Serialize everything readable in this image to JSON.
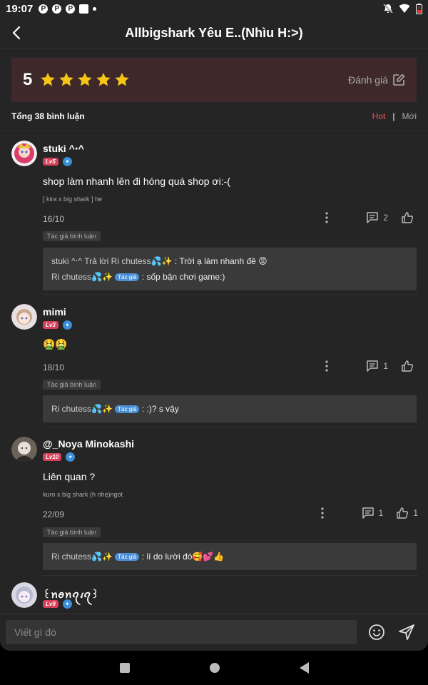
{
  "status_bar": {
    "time": "19:07",
    "pin_letter": "P"
  },
  "header": {
    "title": "Allbigshark Yêu E..(Nhìu H:>)"
  },
  "rating": {
    "score": "5",
    "stars": 5,
    "rate_label": "Đánh giá"
  },
  "summary": {
    "total_label": "Tổng 38 bình luận",
    "sort_hot": "Hot",
    "sort_sep": "|",
    "sort_new": "Mới"
  },
  "comments": [
    {
      "username": "stuki ^‧^",
      "level": "Lv5",
      "text": "shop làm nhanh lên đi hóng quá shop ơi:-(",
      "tag": "[ kira x big shark ] he",
      "date": "16/10",
      "reply_count": "2",
      "like_count": "",
      "author_tag": "Tác giả bình luận",
      "replies": [
        {
          "name": "stuki ^‧^",
          "verb": "Trả lời",
          "target": "Ri chutess💦✨",
          "badge": "",
          "text": ": Trời ạ làm nhanh đê 😡"
        },
        {
          "name": "Ri chutess💦✨",
          "verb": "",
          "target": "",
          "badge": "Tác giả",
          "text": ": sốp bận chơi game:)"
        }
      ]
    },
    {
      "username": "mimi",
      "level": "Lv3",
      "text": "🤮🤮",
      "tag": "",
      "date": "18/10",
      "reply_count": "1",
      "like_count": "",
      "author_tag": "Tác giả bình luận",
      "replies": [
        {
          "name": "Ri chutess💦✨",
          "verb": "",
          "target": "",
          "badge": "Tác giả",
          "text": ": :)? s vậy"
        }
      ]
    },
    {
      "username": "@_Noya Minokashi",
      "level": "Lv10",
      "text": "Liên quan ?",
      "tag": "kuro x big shark (h nhẹ)ngot",
      "date": "22/09",
      "reply_count": "1",
      "like_count": "1",
      "author_tag": "Tác giả bình luận",
      "replies": [
        {
          "name": "Ri chutess💦✨",
          "verb": "",
          "target": "",
          "badge": "Tác giả",
          "text": ": lí do lười đó🥰💕👍"
        }
      ]
    },
    {
      "username": "꒰ꪀꪮꪀꪖꪹꪖ꒱",
      "level": "Lv9",
      "text": "",
      "tag": "",
      "date": "",
      "reply_count": "",
      "like_count": "",
      "author_tag": "",
      "replies": []
    }
  ],
  "input": {
    "placeholder": "Viết gì đó"
  },
  "icons": [
    "back-arrow-icon",
    "star-icon",
    "edit-icon",
    "more-icon",
    "comment-icon",
    "like-icon",
    "emoji-icon",
    "send-icon"
  ],
  "colors": {
    "background": "#252525",
    "accent": "#e8555e",
    "star": "#f5c518",
    "rating_bg": "#3e2829"
  }
}
